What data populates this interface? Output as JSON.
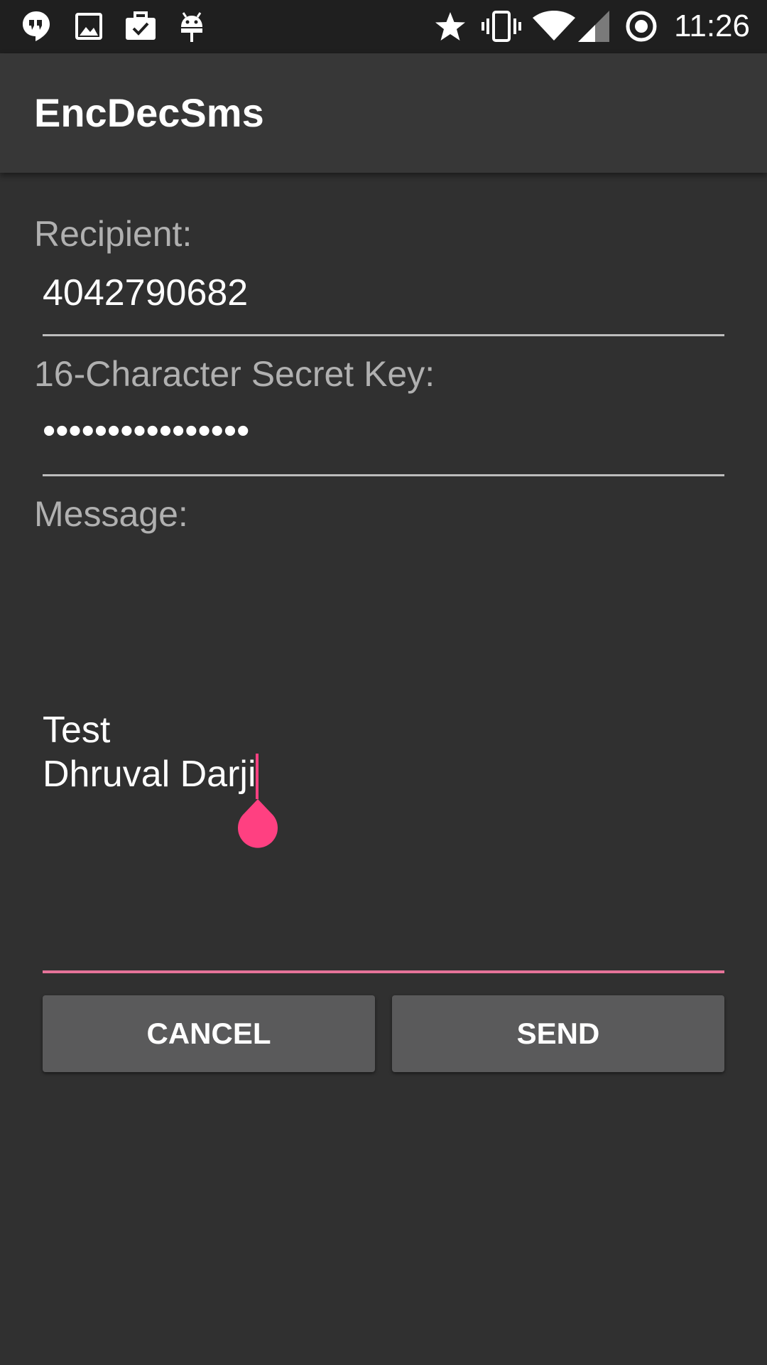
{
  "status_bar": {
    "time": "11:26",
    "left_icons": [
      "hangouts-icon",
      "image-icon",
      "briefcase-icon",
      "android-icon"
    ],
    "right_icons": [
      "star-icon",
      "vibrate-icon",
      "wifi-icon",
      "signal-icon",
      "sync-icon"
    ]
  },
  "app_bar": {
    "title": "EncDecSms"
  },
  "form": {
    "recipient_label": "Recipient:",
    "recipient_value": "4042790682",
    "key_label": "16-Character Secret Key:",
    "key_value": "••••••••••••••••",
    "message_label": "Message:",
    "message_line1": "Test",
    "message_line2": "Dhruval Darji"
  },
  "buttons": {
    "cancel": "CANCEL",
    "send": "SEND"
  },
  "colors": {
    "accent": "#ff4081",
    "background": "#303030",
    "app_bar": "#373737",
    "button": "#5a5a5b"
  }
}
